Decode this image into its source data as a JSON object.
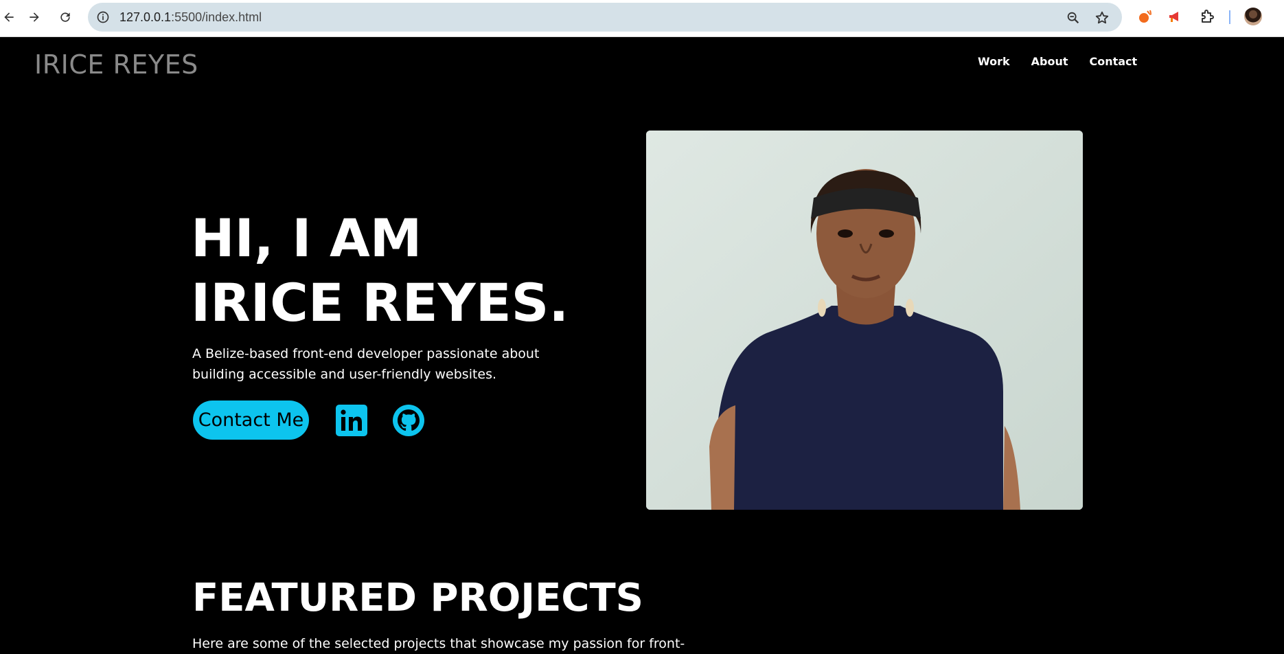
{
  "browser": {
    "url_host": "127.0.0.1",
    "url_path": ":5500/index.html",
    "icons": [
      "back-icon",
      "forward-icon",
      "reload-icon",
      "info-icon",
      "zoom-icon",
      "star-icon",
      "extension-icon",
      "puzzle-icon"
    ]
  },
  "header": {
    "logo": "IRICE REYES",
    "nav": [
      "Work",
      "About",
      "Contact"
    ]
  },
  "hero": {
    "title_line1": "HI, I AM",
    "title_line2": "IRICE REYES.",
    "description": "A Belize-based front-end developer passionate about building accessible and user-friendly websites.",
    "contact_label": "Contact Me",
    "accent_color": "#0dc4ee"
  },
  "featured": {
    "title": "FEATURED PROJECTS",
    "description": "Here are some of the selected projects that showcase my passion for front-"
  }
}
